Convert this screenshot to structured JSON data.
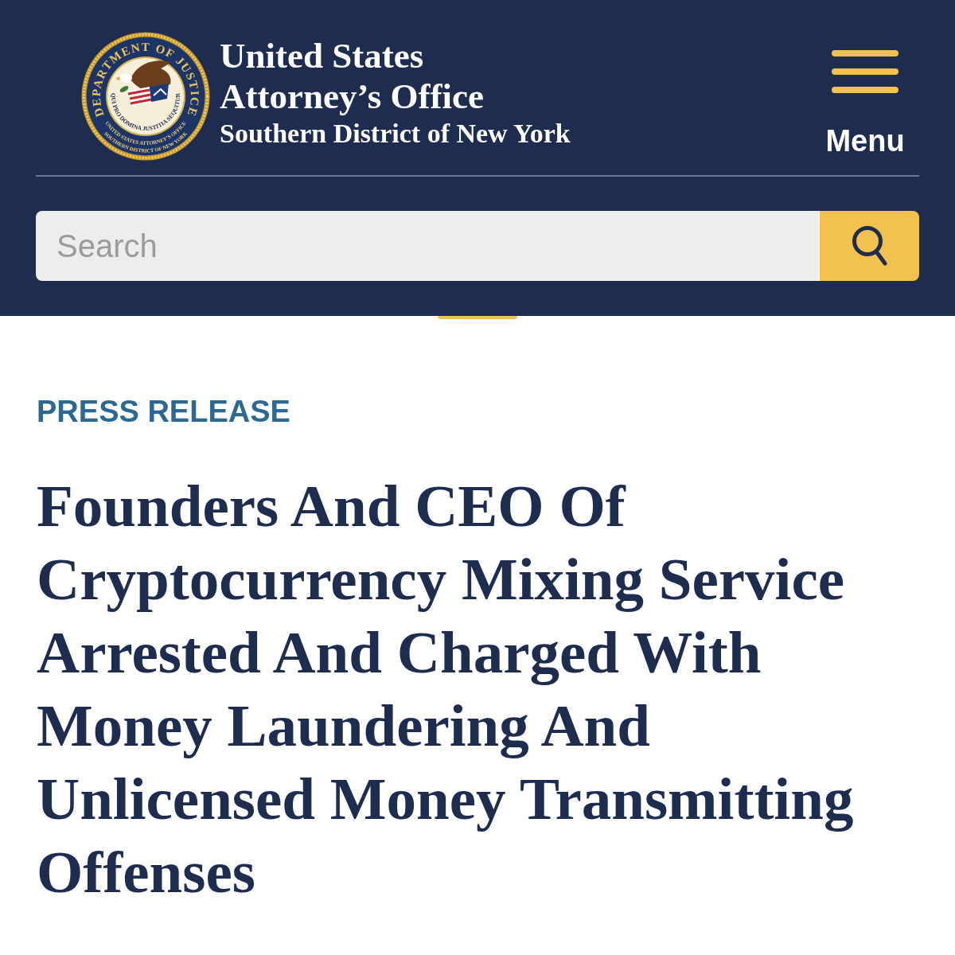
{
  "header": {
    "seal": {
      "ring_text": "DEPARTMENT OF JUSTICE",
      "motto": "QUI PRO DOMINA JUSTITIA SEQUITUR",
      "lower_text": [
        "UNITED STATES ATTORNEY’S OFFICE",
        "SOUTHERN DISTRICT OF NEW YORK"
      ]
    },
    "office_name": "United States Attorney’s Office",
    "district": "Southern District of New York",
    "menu_button": {
      "label": "Menu"
    }
  },
  "search": {
    "placeholder": "Search"
  },
  "article": {
    "category": "PRESS RELEASE",
    "title": "Founders And CEO Of Cryptocurrency Mixing Service Arrested And Charged With Money Laundering And Unlicensed Money Transmitting Offenses"
  }
}
